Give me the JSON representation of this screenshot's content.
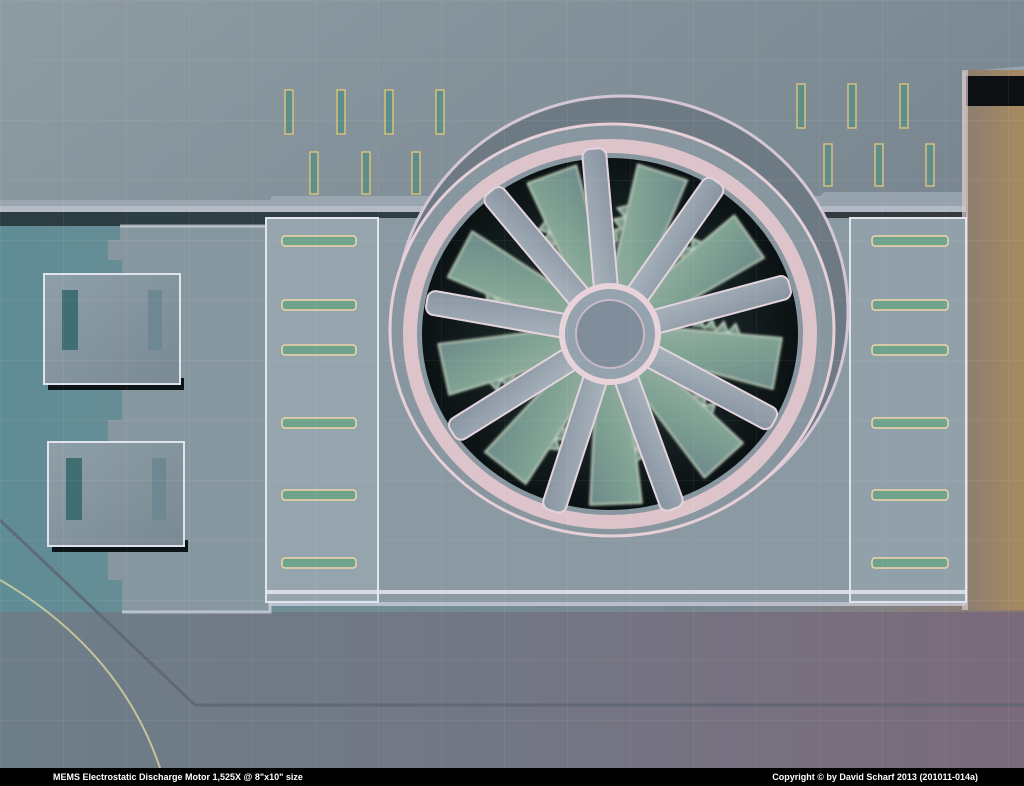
{
  "caption": {
    "left": "MEMS Electrostatic Discharge Motor    1,525X @ 8\"x10\" size",
    "right": "Copyright © by David Scharf 2013    (201011-014a)"
  },
  "colors": {
    "surface": "#7f8f99",
    "surface_light": "#9aa8b2",
    "rim": "#e7c9cf",
    "shadow": "#11181d",
    "bar": "#000000"
  }
}
